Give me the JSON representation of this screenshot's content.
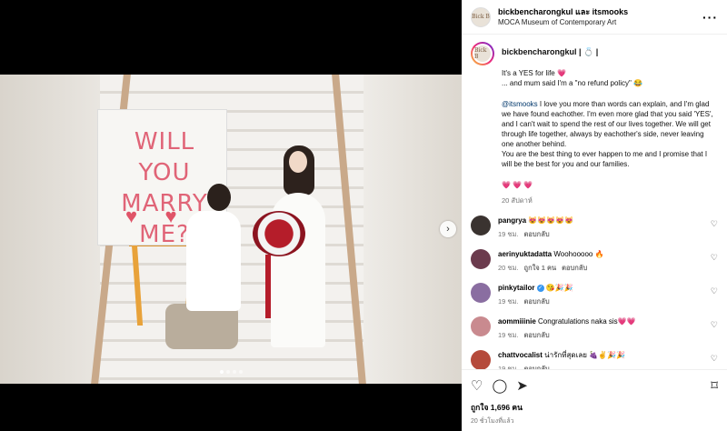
{
  "header": {
    "username": "bickbencharongkul และ itsmooks",
    "location": "MOCA Museum of Contemporary Art",
    "more_icon": "more-horizontal-icon",
    "avatar_text": "Bick B"
  },
  "photo": {
    "sign_line1": "WILL YOU",
    "sign_line2": "MARRY ME?",
    "sign_hearts": [
      "♥",
      "♥",
      "♥"
    ],
    "next_icon": "›"
  },
  "caption": {
    "username": "bickbencharongkul | 💍 |",
    "line1": "It's a YES for life ",
    "line1_emoji": "💗",
    "line2": "... and mum said I'm a \"no refund policy\" 😂",
    "mention": "@itsmooks",
    "para2": " I love you more than words can explain, and I'm glad we have found eachother. I'm even more glad that you said 'YES', and I can't wait to spend the rest of our lives together. We will get through life together, always by eachother's side, never leaving one another behind.",
    "para3": "You are the best thing to ever happen to me and I promise that I will be the best for you and our families.",
    "hearts": "💗 💗 💗",
    "time": "20 สัปดาห์"
  },
  "comments": [
    {
      "name": "pangrya",
      "text": "😻😻😻😻😻",
      "time": "19 ชม.",
      "reply": "ตอบกลับ",
      "likes": "",
      "verified": false,
      "color": "#3a3330"
    },
    {
      "name": "aerinyuktadatta",
      "text": "Woohooooo 🔥",
      "time": "20 ชม.",
      "likes": "ถูกใจ 1 คน",
      "reply": "ตอบกลับ",
      "verified": false,
      "color": "#6b3b4d"
    },
    {
      "name": "pinkytailor",
      "text": "😘🎉🎉",
      "time": "19 ชม.",
      "reply": "ตอบกลับ",
      "likes": "",
      "verified": true,
      "color": "#8a6ea1"
    },
    {
      "name": "aommiiinie",
      "text": "Congratulations naka sis💗💗",
      "time": "19 ชม.",
      "reply": "ตอบกลับ",
      "likes": "",
      "verified": false,
      "color": "#c98a8f"
    },
    {
      "name": "chattvocalist",
      "text": "น่ารักที่สุดเลย 🍇✌️🎉🎉",
      "time": "19 ชม.",
      "reply": "ตอบกลับ",
      "likes": "",
      "verified": false,
      "color": "#b54a3b"
    }
  ],
  "actions": {
    "like_icon": "heart-icon",
    "comment_icon": "comment-icon",
    "share_icon": "share-icon",
    "save_icon": "bookmark-icon",
    "likes": "ถูกใจ 1,696 คน",
    "ago": "20 ชั่วโมงที่แล้ว"
  }
}
